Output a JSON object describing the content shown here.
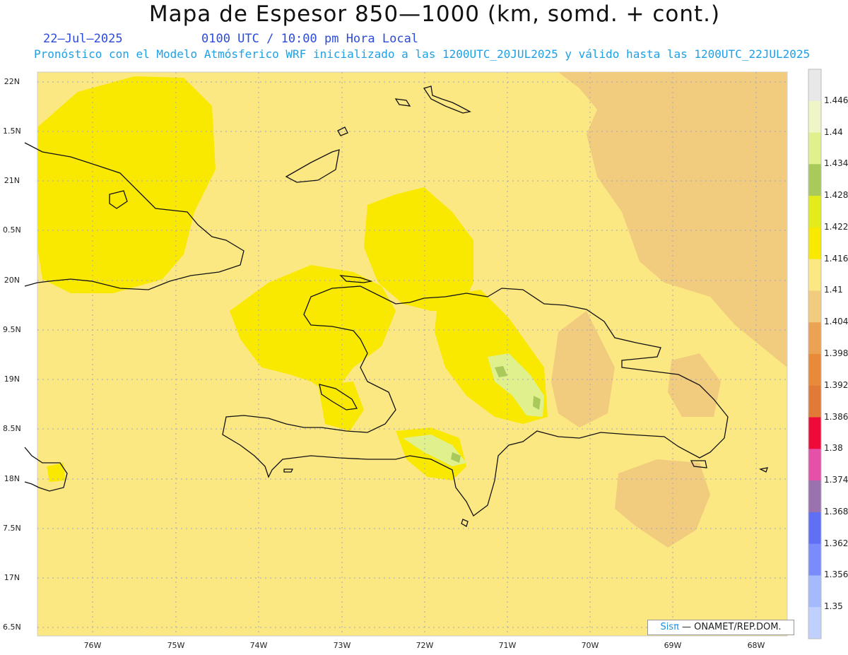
{
  "header": {
    "title": "Mapa de Espesor 850—1000 (km, somd. + cont.)",
    "date": "22—Jul—2025",
    "time": "0100 UTC / 10:00 pm Hora Local",
    "forecast_note": "Pronóstico con el Modelo Atmósferico WRF inicializado a las 1200UTC_20JUL2025 y válido hasta las  1200UTC_22JUL2025"
  },
  "axes": {
    "lat_labels": [
      "22N",
      "1.5N",
      "21N",
      "0.5N",
      "20N",
      "9.5N",
      "19N",
      "8.5N",
      "18N",
      "7.5N",
      "17N",
      "6.5N"
    ],
    "lon_labels": [
      "76W",
      "75W",
      "74W",
      "73W",
      "72W",
      "71W",
      "70W",
      "69W",
      "68W"
    ]
  },
  "colorbar": {
    "labels": [
      "1.446",
      "1.44",
      "1.434",
      "1.428",
      "1.422",
      "1.416",
      "1.41",
      "1.404",
      "1.398",
      "1.392",
      "1.386",
      "1.38",
      "1.374",
      "1.368",
      "1.362",
      "1.356",
      "1.35"
    ],
    "colors": [
      "#e8e8e8",
      "#f0f5c8",
      "#dff08c",
      "#a9c95a",
      "#e3ec1a",
      "#f9e900",
      "#fce883",
      "#f1cb7e",
      "#eba353",
      "#e88a3a",
      "#e07a36",
      "#ee0b3a",
      "#e550a8",
      "#9a72b0",
      "#6070f4",
      "#7a8cfc",
      "#a4bafd",
      "#c0d0fe"
    ]
  },
  "legend_colors": {
    "base": "#fce883",
    "high": "#f9e900",
    "higher": "#dff08c",
    "peak": "#a9c95a",
    "low": "#f1cb7e"
  },
  "credit": {
    "brand": "Sisπ",
    "rest": " — ONAMET/REP.DOM."
  }
}
